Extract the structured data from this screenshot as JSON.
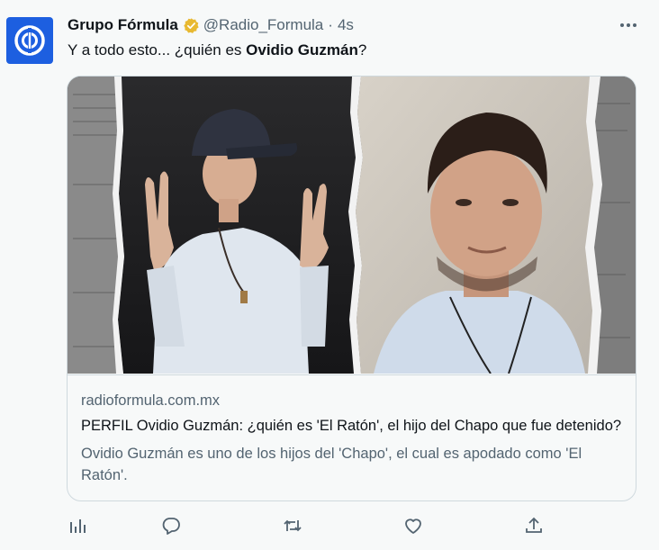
{
  "tweet": {
    "author_name": "Grupo Fórmula",
    "handle": "@Radio_Formula",
    "separator": "·",
    "time": "4s",
    "text_before": "Y a todo esto... ¿quién es ",
    "text_bold": "Ovidio Guzmán",
    "text_after": "?"
  },
  "card": {
    "domain": "radioformula.com.mx",
    "title": "PERFIL Ovidio Guzmán: ¿quién es 'El Ratón', el hijo del Chapo que fue detenido?",
    "description": "Ovidio Guzmán es uno de los hijos del 'Chapo', el cual es apodado como 'El Ratón'.",
    "image_alt": "two photos of a man"
  },
  "icons": {
    "verified": "verified-badge-icon",
    "more": "more-icon",
    "views": "views-icon",
    "reply": "reply-icon",
    "retweet": "retweet-icon",
    "like": "like-icon",
    "share": "share-icon"
  },
  "colors": {
    "brand": "#1d5fe0",
    "verified": "#e8b931",
    "secondary_text": "#536471",
    "border": "#cfd9de"
  }
}
